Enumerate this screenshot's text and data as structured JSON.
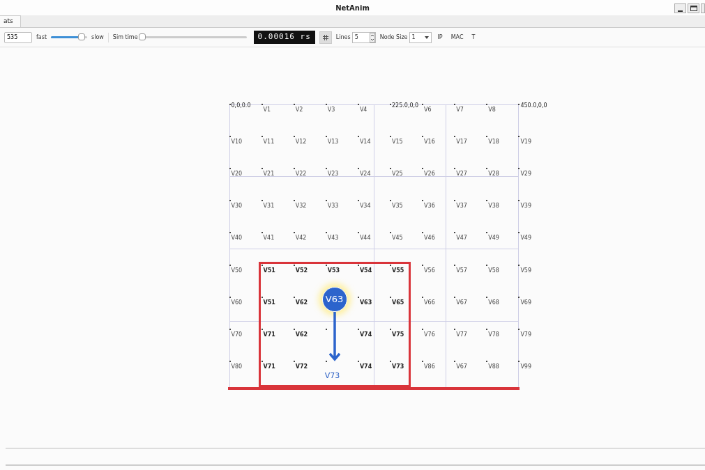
{
  "window": {
    "title": "NetAnim"
  },
  "tabs": [
    {
      "label": "ats",
      "selected": true
    }
  ],
  "toolbar": {
    "field_value": "535",
    "fast_label": "fast",
    "speed_slider": {
      "level": 0.85
    },
    "slow_label": "slow",
    "sim_time_label": "Sim time",
    "sim_time_slider": {
      "level": 0
    },
    "time_display": "0.00016 rs",
    "grid_toggle": {
      "on": true
    },
    "lines_label": "Lines",
    "lines_value": "5",
    "node_size_label": "Node Size",
    "node_size_value": "1",
    "ip_button": "IP",
    "mac_button": "MAC",
    "t_button": "T"
  },
  "canvas": {
    "rows": [
      [
        {
          "label": "0,0,0.0",
          "kind": "coordinate"
        },
        {
          "label": "V1",
          "kind": "normal"
        },
        {
          "label": "V2",
          "kind": "normal"
        },
        {
          "label": "V3",
          "kind": "normal"
        },
        {
          "label": "V4",
          "kind": "normal"
        },
        {
          "label": "225.0,0,0",
          "kind": "coordinate"
        },
        {
          "label": "V6",
          "kind": "normal"
        },
        {
          "label": "V7",
          "kind": "normal"
        },
        {
          "label": "V8",
          "kind": "normal"
        },
        {
          "label": "450.0,0,0",
          "kind": "coordinate"
        }
      ],
      [
        {
          "label": "V10",
          "kind": "normal"
        },
        {
          "label": "V11",
          "kind": "normal"
        },
        {
          "label": "V12",
          "kind": "normal"
        },
        {
          "label": "V13",
          "kind": "normal"
        },
        {
          "label": "V14",
          "kind": "normal"
        },
        {
          "label": "V15",
          "kind": "normal"
        },
        {
          "label": "V16",
          "kind": "normal"
        },
        {
          "label": "V17",
          "kind": "normal"
        },
        {
          "label": "V18",
          "kind": "normal"
        },
        {
          "label": "V19",
          "kind": "normal"
        }
      ],
      [
        {
          "label": "V20",
          "kind": "normal"
        },
        {
          "label": "V21",
          "kind": "normal"
        },
        {
          "label": "V22",
          "kind": "normal"
        },
        {
          "label": "V23",
          "kind": "normal"
        },
        {
          "label": "V24",
          "kind": "normal"
        },
        {
          "label": "V25",
          "kind": "normal"
        },
        {
          "label": "V26",
          "kind": "normal"
        },
        {
          "label": "V27",
          "kind": "normal"
        },
        {
          "label": "V28",
          "kind": "normal"
        },
        {
          "label": "V29",
          "kind": "normal"
        }
      ],
      [
        {
          "label": "V30",
          "kind": "normal"
        },
        {
          "label": "V31",
          "kind": "normal"
        },
        {
          "label": "V32",
          "kind": "normal"
        },
        {
          "label": "V33",
          "kind": "normal"
        },
        {
          "label": "V34",
          "kind": "normal"
        },
        {
          "label": "V35",
          "kind": "normal"
        },
        {
          "label": "V36",
          "kind": "normal"
        },
        {
          "label": "V37",
          "kind": "normal"
        },
        {
          "label": "V38",
          "kind": "normal"
        },
        {
          "label": "V39",
          "kind": "normal"
        }
      ],
      [
        {
          "label": "V40",
          "kind": "normal"
        },
        {
          "label": "V41",
          "kind": "normal"
        },
        {
          "label": "V42",
          "kind": "normal"
        },
        {
          "label": "V43",
          "kind": "normal"
        },
        {
          "label": "V44",
          "kind": "normal"
        },
        {
          "label": "V45",
          "kind": "normal"
        },
        {
          "label": "V46",
          "kind": "normal"
        },
        {
          "label": "V47",
          "kind": "normal"
        },
        {
          "label": "V49",
          "kind": "normal"
        },
        {
          "label": "V49",
          "kind": "normal"
        }
      ],
      [
        {
          "label": "V50",
          "kind": "normal"
        },
        {
          "label": "V51",
          "kind": "bold"
        },
        {
          "label": "V52",
          "kind": "bold"
        },
        {
          "label": "V53",
          "kind": "bold"
        },
        {
          "label": "V54",
          "kind": "bold"
        },
        {
          "label": "V55",
          "kind": "bold"
        },
        {
          "label": "V56",
          "kind": "normal"
        },
        {
          "label": "V57",
          "kind": "normal"
        },
        {
          "label": "V58",
          "kind": "normal"
        },
        {
          "label": "V59",
          "kind": "normal"
        }
      ],
      [
        {
          "label": "V60",
          "kind": "normal"
        },
        {
          "label": "V51",
          "kind": "bold"
        },
        {
          "label": "V62",
          "kind": "bold"
        },
        {
          "label": "V63",
          "kind": "highlight"
        },
        {
          "label": "V63",
          "kind": "bold"
        },
        {
          "label": "V65",
          "kind": "bold"
        },
        {
          "label": "V66",
          "kind": "normal"
        },
        {
          "label": "V67",
          "kind": "normal"
        },
        {
          "label": "V68",
          "kind": "normal"
        },
        {
          "label": "V69",
          "kind": "normal"
        }
      ],
      [
        {
          "label": "V70",
          "kind": "normal"
        },
        {
          "label": "V71",
          "kind": "bold"
        },
        {
          "label": "V62",
          "kind": "bold"
        },
        {
          "kind": "covered"
        },
        {
          "label": "V74",
          "kind": "bold"
        },
        {
          "label": "V75",
          "kind": "bold"
        },
        {
          "label": "V76",
          "kind": "normal"
        },
        {
          "label": "V77",
          "kind": "normal"
        },
        {
          "label": "V78",
          "kind": "normal"
        },
        {
          "label": "V79",
          "kind": "normal"
        }
      ],
      [
        {
          "label": "V80",
          "kind": "normal"
        },
        {
          "label": "V71",
          "kind": "bold"
        },
        {
          "label": "V72",
          "kind": "bold"
        },
        {
          "label": "V73",
          "kind": "target"
        },
        {
          "label": "V74",
          "kind": "bold"
        },
        {
          "label": "V73",
          "kind": "bold"
        },
        {
          "label": "V86",
          "kind": "normal"
        },
        {
          "label": "V67",
          "kind": "normal"
        },
        {
          "label": "V88",
          "kind": "normal"
        },
        {
          "label": "V99",
          "kind": "normal"
        }
      ]
    ]
  }
}
